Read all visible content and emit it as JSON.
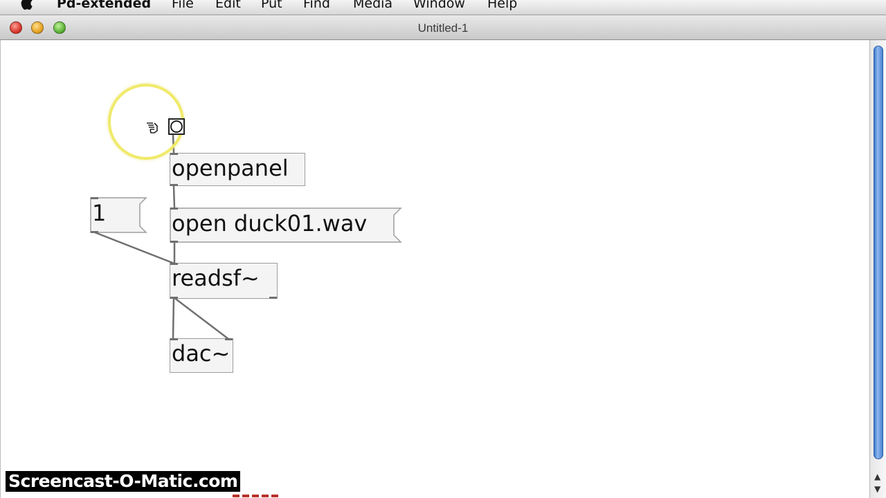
{
  "menubar": {
    "items": [
      {
        "label": "Pd-extended"
      },
      {
        "label": "File"
      },
      {
        "label": "Edit"
      },
      {
        "label": "Put"
      },
      {
        "label": "Find"
      },
      {
        "label": "Media"
      },
      {
        "label": "Window"
      },
      {
        "label": "Help"
      }
    ]
  },
  "window": {
    "title": "Untitled-1"
  },
  "patch": {
    "objects": [
      {
        "text": "openpanel"
      },
      {
        "text": "readsf~"
      },
      {
        "text": "dac~"
      }
    ],
    "messages": [
      {
        "text": "1"
      },
      {
        "text": "open duck01.wav"
      }
    ]
  },
  "watermark": {
    "text": "Screencast-O-Matic.com"
  },
  "colors": {
    "box_fill": "#f4f4f4",
    "box_border": "#9d9d9d",
    "wire": "#6f6f6f",
    "highlight": "#f0ea6a",
    "scroll_thumb": "#3b76c8"
  },
  "icons": [
    "apple-icon",
    "hand-pointer-icon",
    "bang-icon",
    "scroll-up-arrow-icon",
    "scroll-down-arrow-icon"
  ]
}
